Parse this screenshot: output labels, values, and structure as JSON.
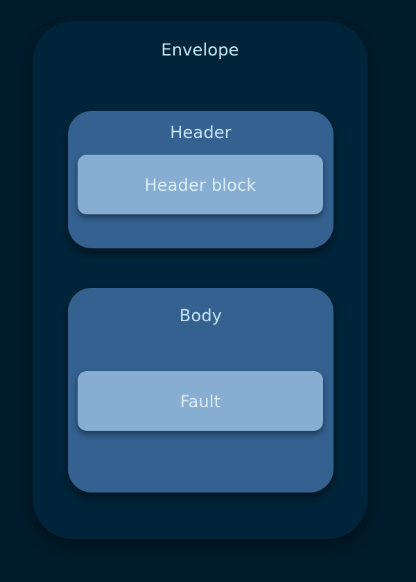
{
  "envelope": {
    "label": "Envelope"
  },
  "header": {
    "label": "Header",
    "block_label": "Header block"
  },
  "body": {
    "label": "Body",
    "fault_label": "Fault"
  },
  "colors": {
    "background": "#001b2b",
    "envelope": "#00253a",
    "section": "#34618f",
    "block": "#87aed0",
    "text": "#c9e6f8"
  }
}
